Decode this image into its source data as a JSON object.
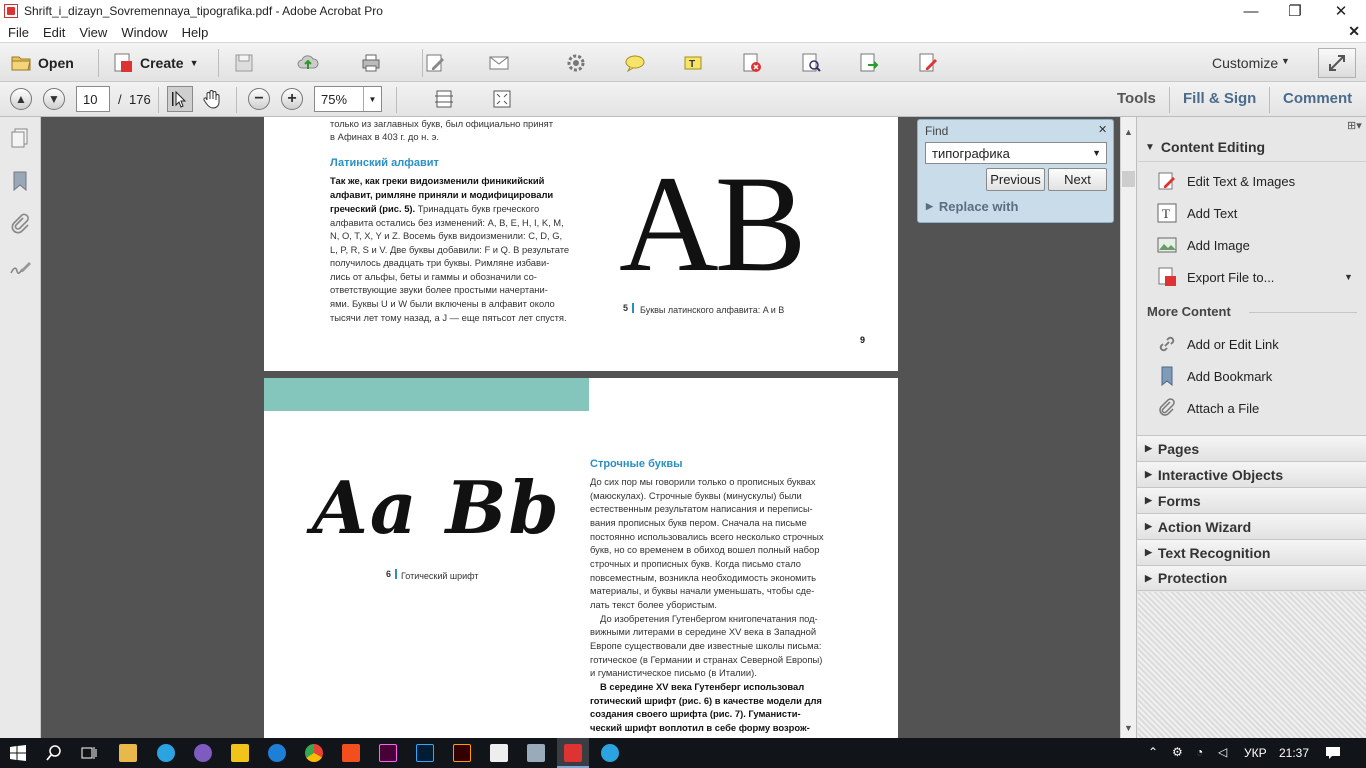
{
  "window": {
    "title": "Shrift_i_dizayn_Sovremennaya_tipografika.pdf - Adobe Acrobat Pro",
    "controls": {
      "minimize": "—",
      "maximize": "❐",
      "close": "✕"
    }
  },
  "menu": {
    "items": [
      "File",
      "Edit",
      "View",
      "Window",
      "Help"
    ],
    "close_doc": "✕"
  },
  "toolbar": {
    "open_label": "Open",
    "create_label": "Create",
    "customize_label": "Customize"
  },
  "nav": {
    "page_current": "10",
    "page_separator": "/",
    "page_total": "176",
    "zoom": "75%",
    "tools_label": "Tools",
    "fillsign_label": "Fill & Sign",
    "comment_label": "Comment"
  },
  "find": {
    "title": "Find",
    "query": "типографика",
    "previous_label": "Previous",
    "next_label": "Next",
    "replace_label": "Replace with"
  },
  "right_panel": {
    "content_editing": {
      "title": "Content Editing",
      "items": [
        "Edit Text & Images",
        "Add Text",
        "Add Image",
        "Export File to..."
      ]
    },
    "more_content": {
      "title": "More Content",
      "items": [
        "Add or Edit Link",
        "Add Bookmark",
        "Attach a File"
      ]
    },
    "sections": [
      "Pages",
      "Interactive Objects",
      "Forms",
      "Action Wizard",
      "Text Recognition",
      "Protection"
    ]
  },
  "page9": {
    "top_text": [
      "только из заглавных букв, был официально принят",
      "в Афинах в 403 г. до н. э."
    ],
    "heading": "Латинский алфавит",
    "bold_lines": [
      "Так же, как греки видоизменили финикийский",
      "алфавит, римляне приняли и модифицировали",
      "греческий (рис. 5)."
    ],
    "body_first_tail": " Тринадцать букв греческого",
    "body_lines": [
      "алфавита остались без изменений: A, B, E, H, I, K, M,",
      "N, O, T, X, Y и Z. Восемь букв видоизменили: C, D, G,",
      "L, P, R, S и V. Две буквы добавили: F и Q. В результате",
      "получилось двадцать три буквы. Римляне избави-",
      "лись от альфы, беты и гаммы и обозначили со-",
      "ответствующие звуки более простыми начертани-",
      "ями. Буквы U и W были включены в алфавит около",
      "тысячи лет тому назад, а J — еще пятьсот лет спустя."
    ],
    "figure_letters": "AB",
    "figure_num": "5",
    "figure_caption": "Буквы латинского алфавита: A и B",
    "page_number": "9"
  },
  "page10": {
    "figure_letters": "Aa Bb",
    "figure_num": "6",
    "figure_caption": "Готический шрифт",
    "heading": "Строчные буквы",
    "para1": [
      "До сих пор мы говорили только о прописных буквах",
      "(маюскулах). Строчные буквы (минускулы) были",
      "естественным результатом написания и переписы-",
      "вания прописных букв пером. Сначала на письме",
      "постоянно использовались всего несколько строчных",
      "букв, но со временем в обиход вошел полный набор",
      "строчных и прописных букв. Когда письмо стало",
      "повсеместным, возникла необходимость экономить",
      "материалы, и буквы начали уменьшать, чтобы сде-",
      "лать текст более убористым."
    ],
    "para2": [
      "До изобретения Гутенбергом книгопечатания под-",
      "вижными литерами в середине XV века в Западной",
      "Европе существовали две известные школы письма:",
      "готическое (в Германии и странах Северной Европы)",
      "и гуманистическое письмо (в Италии)."
    ],
    "para3": [
      "В середине XV века Гутенберг использовал",
      "готический шрифт (рис. 6) в качестве модели для",
      "создания своего шрифта (рис. 7). Гуманисти-",
      "ческий шрифт воплотил в себе форму возрож-"
    ]
  },
  "taskbar": {
    "lang": "УКР",
    "time": "21:37"
  }
}
